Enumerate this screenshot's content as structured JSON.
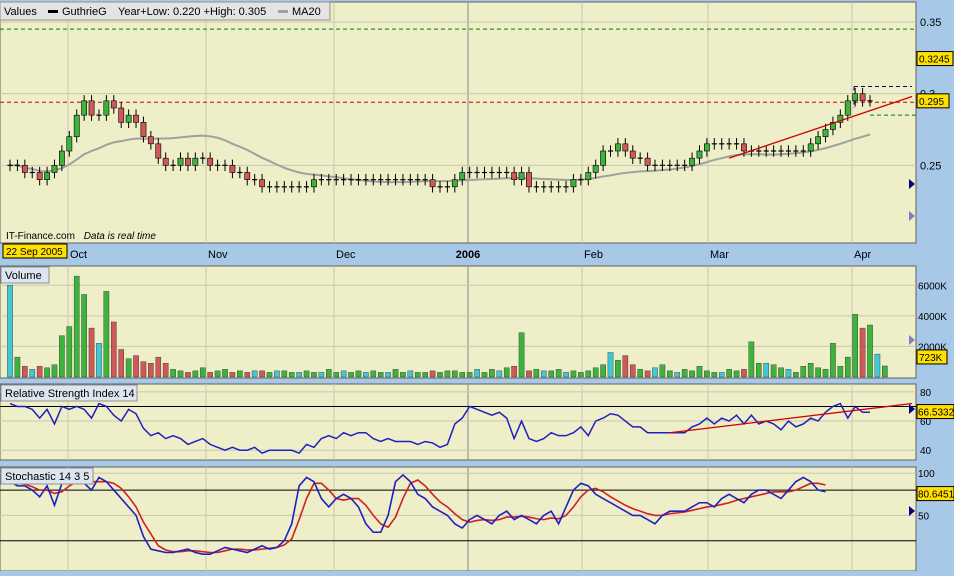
{
  "chart_data": {
    "type": "candlestick",
    "symbol": "GuthrieG",
    "legend": {
      "values_label": "Values",
      "symbol_label": "GuthrieG",
      "range_text": "Year+Low: 0.220 +High: 0.305",
      "ma_label": "MA20"
    },
    "price_axis": {
      "min": 0.2,
      "max": 0.35,
      "ticks": [
        "0.35",
        "0.3",
        "0.25"
      ]
    },
    "price_badges": {
      "upper": "0.3245",
      "last": "0.295"
    },
    "reference_lines": {
      "green_upper": 0.345,
      "red_mid": 0.294,
      "green_lower": 0.285
    },
    "x_labels": [
      "Oct",
      "Nov",
      "Dec",
      "2006",
      "Feb",
      "Mar",
      "Apr"
    ],
    "start_date_badge": "22 Sep 2005",
    "watermark": "IT-Finance.com",
    "realtime_note": "Data is real time",
    "close": [
      0.25,
      0.25,
      0.245,
      0.245,
      0.24,
      0.245,
      0.25,
      0.26,
      0.27,
      0.285,
      0.295,
      0.285,
      0.285,
      0.295,
      0.29,
      0.28,
      0.285,
      0.28,
      0.27,
      0.265,
      0.255,
      0.25,
      0.25,
      0.255,
      0.25,
      0.255,
      0.255,
      0.25,
      0.25,
      0.25,
      0.245,
      0.245,
      0.24,
      0.24,
      0.235,
      0.235,
      0.235,
      0.235,
      0.235,
      0.235,
      0.235,
      0.24,
      0.24,
      0.24,
      0.24,
      0.24,
      0.24,
      0.24,
      0.24,
      0.24,
      0.24,
      0.24,
      0.24,
      0.24,
      0.24,
      0.24,
      0.24,
      0.235,
      0.235,
      0.235,
      0.24,
      0.245,
      0.245,
      0.245,
      0.245,
      0.245,
      0.245,
      0.245,
      0.24,
      0.245,
      0.235,
      0.235,
      0.235,
      0.235,
      0.235,
      0.235,
      0.24,
      0.24,
      0.245,
      0.25,
      0.26,
      0.26,
      0.265,
      0.26,
      0.255,
      0.255,
      0.25,
      0.25,
      0.25,
      0.25,
      0.25,
      0.25,
      0.255,
      0.26,
      0.265,
      0.265,
      0.265,
      0.265,
      0.265,
      0.26,
      0.26,
      0.26,
      0.26,
      0.26,
      0.26,
      0.26,
      0.26,
      0.26,
      0.265,
      0.27,
      0.275,
      0.28,
      0.285,
      0.295,
      0.3,
      0.295,
      0.295
    ],
    "volume_axis": {
      "max_k": 7000,
      "ticks": [
        "6000K",
        "4000K",
        "2000K"
      ],
      "last": "723K"
    },
    "volume_k": [
      6000,
      1300,
      700,
      500,
      700,
      600,
      800,
      2700,
      3300,
      6600,
      5400,
      3200,
      2200,
      5600,
      3600,
      1800,
      1200,
      1400,
      1000,
      900,
      1300,
      900,
      500,
      400,
      300,
      400,
      600,
      300,
      400,
      500,
      300,
      400,
      300,
      400,
      400,
      300,
      400,
      400,
      300,
      300,
      400,
      300,
      300,
      500,
      300,
      400,
      300,
      400,
      300,
      400,
      300,
      300,
      500,
      300,
      400,
      300,
      300,
      400,
      300,
      400,
      400,
      300,
      300,
      500,
      300,
      500,
      400,
      600,
      700,
      2900,
      400,
      500,
      400,
      400,
      500,
      300,
      400,
      300,
      400,
      600,
      800,
      1600,
      1100,
      1400,
      800,
      500,
      400,
      600,
      800,
      400,
      300,
      500,
      400,
      700,
      400,
      300,
      300,
      500,
      400,
      500,
      2300,
      900,
      900,
      800,
      600,
      500,
      300,
      700,
      900,
      600,
      500,
      2200,
      700,
      1300,
      4100,
      3200,
      3400,
      1500,
      723
    ],
    "rsi": {
      "label": "Relative Strength Index 14",
      "ticks": [
        "80",
        "60",
        "40"
      ],
      "last": "66.5332",
      "values": [
        72,
        70,
        70,
        68,
        62,
        68,
        58,
        70,
        68,
        70,
        68,
        62,
        72,
        70,
        64,
        60,
        68,
        65,
        55,
        50,
        52,
        48,
        50,
        48,
        44,
        46,
        48,
        44,
        42,
        40,
        42,
        40,
        40,
        42,
        38,
        40,
        40,
        40,
        40,
        38,
        44,
        42,
        48,
        50,
        48,
        52,
        50,
        52,
        52,
        48,
        46,
        48,
        46,
        46,
        46,
        44,
        46,
        45,
        42,
        44,
        58,
        62,
        70,
        68,
        66,
        64,
        66,
        62,
        48,
        60,
        48,
        46,
        48,
        52,
        50,
        50,
        52,
        56,
        50,
        60,
        62,
        65,
        64,
        60,
        56,
        56,
        52,
        52,
        52,
        52,
        52,
        52,
        56,
        58,
        62,
        58,
        62,
        60,
        64,
        58,
        64,
        58,
        60,
        58,
        54,
        60,
        56,
        58,
        62,
        60,
        66,
        70,
        72,
        62,
        70,
        66,
        66
      ]
    },
    "stochastic": {
      "label": "Stochastic 14 3 5",
      "ticks": [
        "100",
        "50"
      ],
      "last": "80.6451",
      "k": [
        90,
        85,
        85,
        80,
        72,
        85,
        62,
        88,
        92,
        95,
        88,
        80,
        95,
        90,
        80,
        70,
        60,
        50,
        25,
        10,
        8,
        6,
        6,
        8,
        10,
        6,
        4,
        4,
        8,
        12,
        10,
        8,
        6,
        10,
        14,
        10,
        12,
        20,
        40,
        85,
        95,
        90,
        70,
        60,
        70,
        75,
        70,
        60,
        40,
        30,
        30,
        50,
        90,
        98,
        90,
        75,
        70,
        60,
        55,
        50,
        40,
        35,
        45,
        50,
        45,
        40,
        50,
        55,
        45,
        50,
        45,
        40,
        50,
        55,
        40,
        60,
        80,
        88,
        85,
        75,
        70,
        65,
        60,
        55,
        50,
        50,
        45,
        40,
        50,
        55,
        55,
        55,
        60,
        65,
        65,
        60,
        70,
        75,
        70,
        65,
        75,
        80,
        80,
        75,
        70,
        80,
        90,
        95,
        90,
        80,
        78
      ],
      "d": [
        88,
        88,
        87,
        84,
        80,
        80,
        76,
        78,
        85,
        90,
        92,
        90,
        90,
        90,
        88,
        82,
        72,
        60,
        42,
        28,
        14,
        9,
        7,
        7,
        8,
        8,
        7,
        6,
        6,
        8,
        10,
        10,
        9,
        9,
        10,
        11,
        12,
        15,
        22,
        45,
        70,
        88,
        88,
        80,
        70,
        68,
        70,
        70,
        62,
        50,
        40,
        36,
        48,
        70,
        88,
        92,
        85,
        75,
        66,
        60,
        52,
        45,
        42,
        44,
        45,
        44,
        45,
        48,
        48,
        49,
        48,
        46,
        45,
        47,
        46,
        50,
        60,
        72,
        80,
        82,
        78,
        72,
        67,
        62,
        58,
        55,
        52,
        50,
        50,
        52,
        53,
        54,
        56,
        58,
        60,
        61,
        63,
        65,
        68,
        70,
        72,
        74,
        76,
        78,
        78,
        78,
        80,
        84,
        88,
        88,
        86
      ]
    }
  }
}
